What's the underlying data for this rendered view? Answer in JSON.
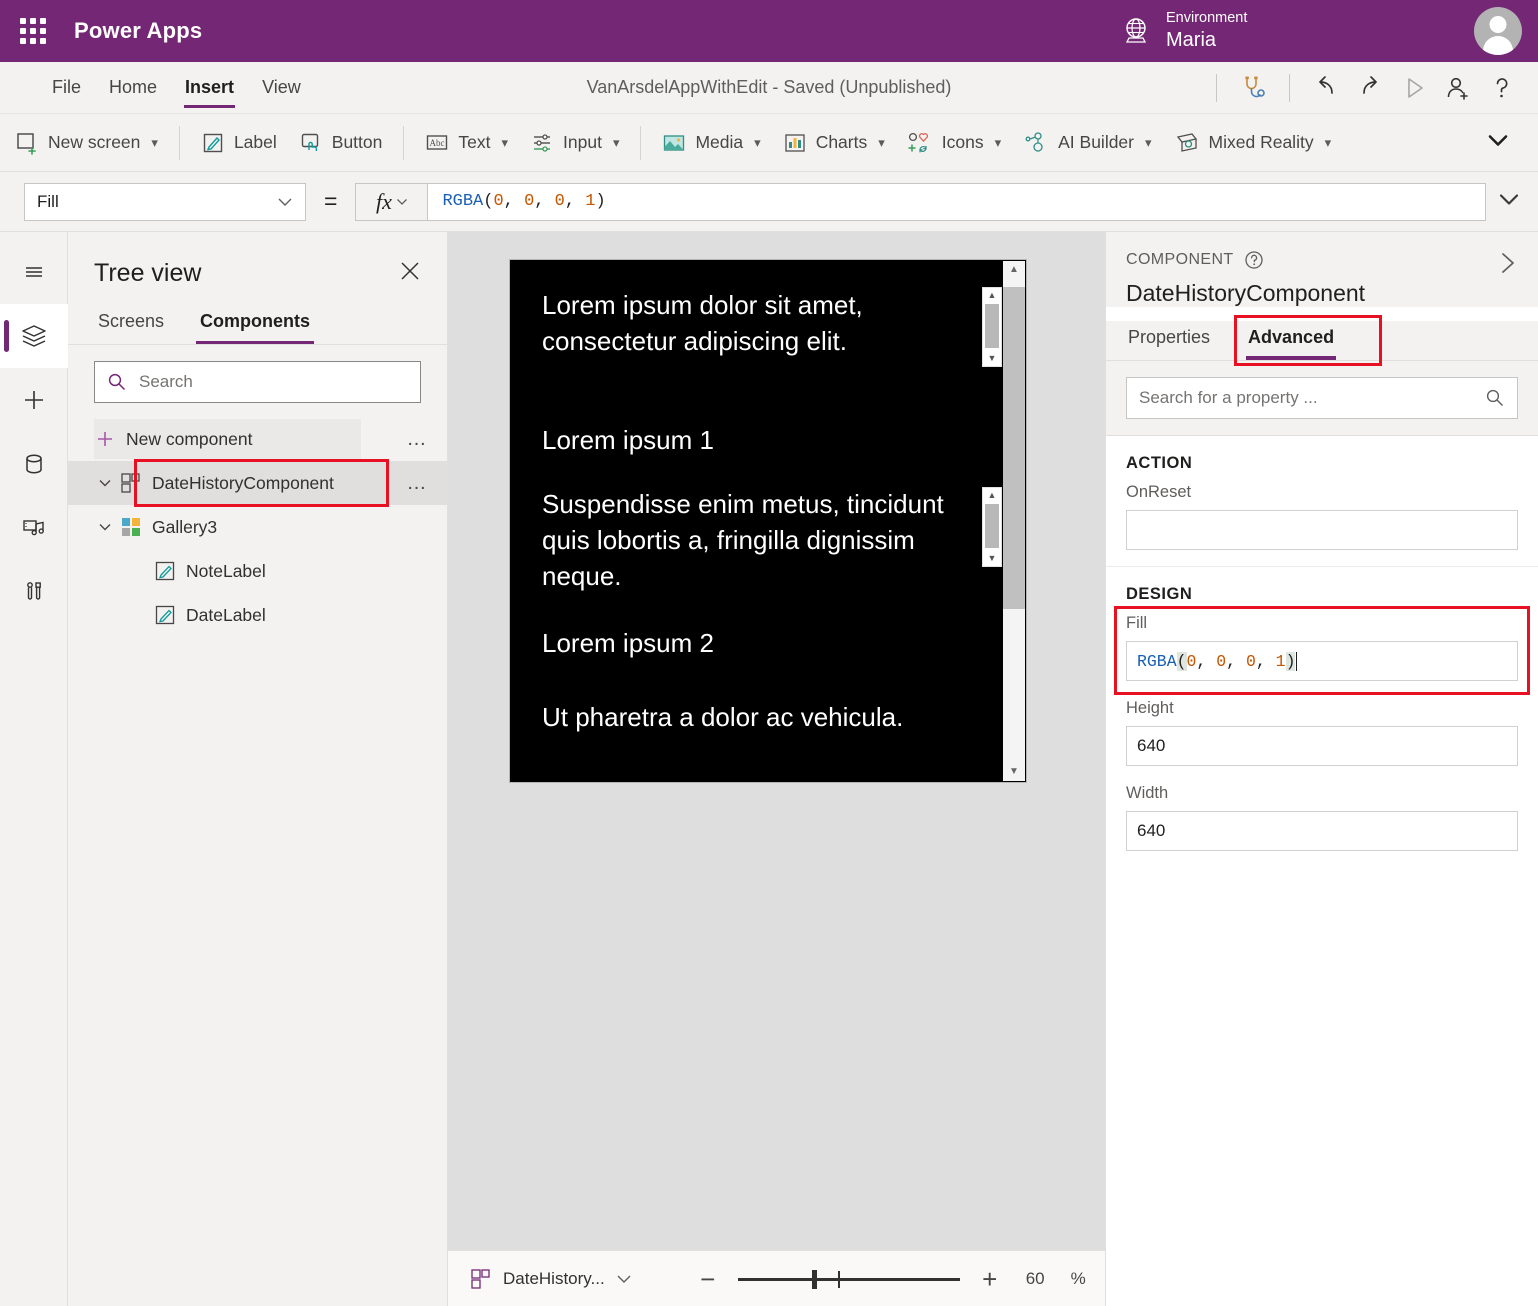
{
  "topbar": {
    "brand": "Power Apps",
    "waffle_icon": "app-launcher-icon",
    "environment_label": "Environment",
    "environment_name": "Maria",
    "globe_icon": "globe-icon",
    "avatar_icon": "user-avatar"
  },
  "menubar": {
    "items": [
      {
        "label": "File",
        "active": false
      },
      {
        "label": "Home",
        "active": false
      },
      {
        "label": "Insert",
        "active": true
      },
      {
        "label": "View",
        "active": false
      }
    ],
    "app_title": "VanArsdelAppWithEdit - Saved (Unpublished)",
    "tools": [
      {
        "name": "app-checker-icon",
        "title": "App checker"
      },
      {
        "name": "undo-icon",
        "title": "Undo"
      },
      {
        "name": "redo-icon",
        "title": "Redo"
      },
      {
        "name": "preview-play-icon",
        "title": "Preview the app"
      },
      {
        "name": "share-user-icon",
        "title": "Share"
      },
      {
        "name": "help-icon",
        "title": "Help"
      }
    ]
  },
  "ribbon": {
    "items": [
      {
        "label": "New screen",
        "icon": "new-screen-icon",
        "has_chevron": true
      },
      {
        "label": "Label",
        "icon": "label-icon",
        "has_chevron": false
      },
      {
        "label": "Button",
        "icon": "button-icon",
        "has_chevron": false
      },
      {
        "label": "Text",
        "icon": "text-icon",
        "has_chevron": true
      },
      {
        "label": "Input",
        "icon": "input-icon",
        "has_chevron": true
      },
      {
        "label": "Media",
        "icon": "media-icon",
        "has_chevron": true
      },
      {
        "label": "Charts",
        "icon": "charts-icon",
        "has_chevron": true
      },
      {
        "label": "Icons",
        "icon": "icons-icon",
        "has_chevron": true
      },
      {
        "label": "AI Builder",
        "icon": "ai-builder-icon",
        "has_chevron": true
      },
      {
        "label": "Mixed Reality",
        "icon": "mixed-reality-icon",
        "has_chevron": true
      }
    ],
    "expand_icon": "chevron-down-icon"
  },
  "formula_bar": {
    "property": "Fill",
    "equals": "=",
    "fx_label": "fx",
    "formula": {
      "function": "RGBA",
      "open": "(",
      "args": [
        "0",
        "0",
        "0",
        "1"
      ],
      "close": ")",
      "full": "RGBA(0, 0, 0, 1)"
    },
    "expand_icon": "chevron-down-icon"
  },
  "rail": {
    "items": [
      {
        "name": "hamburger-menu-icon",
        "active": false
      },
      {
        "name": "tree-view-layers-icon",
        "active": true
      },
      {
        "name": "insert-plus-icon",
        "active": false
      },
      {
        "name": "data-sources-icon",
        "active": false
      },
      {
        "name": "media-library-icon",
        "active": false
      },
      {
        "name": "advanced-tools-icon",
        "active": false
      }
    ]
  },
  "tree_view": {
    "title": "Tree view",
    "close_icon": "close-icon",
    "tabs": [
      {
        "label": "Screens",
        "active": false
      },
      {
        "label": "Components",
        "active": true
      }
    ],
    "search_placeholder": "Search",
    "search_value": "",
    "search_icon": "search-icon",
    "new_component_label": "New component",
    "new_component_icon": "plus-icon",
    "overflow_icon": "ellipsis-icon",
    "nodes": [
      {
        "label": "DateHistoryComponent",
        "icon": "component-icon",
        "level": 0,
        "expanded": true,
        "selected": true,
        "highlighted": true
      },
      {
        "label": "Gallery3",
        "icon": "gallery-icon",
        "level": 1,
        "expanded": true,
        "selected": false,
        "highlighted": false
      },
      {
        "label": "NoteLabel",
        "icon": "label-icon",
        "level": 2,
        "expanded": false,
        "selected": false,
        "highlighted": false
      },
      {
        "label": "DateLabel",
        "icon": "label-icon",
        "level": 2,
        "expanded": false,
        "selected": false,
        "highlighted": false
      }
    ]
  },
  "canvas": {
    "background_color": "#dedede",
    "component_fill": "#000000",
    "gallery_items": [
      {
        "note": "Lorem ipsum dolor sit amet, consectetur adipiscing elit.",
        "date": "Lorem ipsum 1"
      },
      {
        "note": "Suspendisse enim metus, tincidunt quis lobortis a, fringilla dignissim neque.",
        "date": "Lorem ipsum 2"
      },
      {
        "note": "Ut pharetra a dolor ac vehicula.",
        "date": ""
      }
    ]
  },
  "status_bar": {
    "component_name": "DateHistory...",
    "component_icon": "component-icon",
    "component_chevron": "chevron-down-icon",
    "zoom_out_icon": "minus-icon",
    "zoom_in_icon": "plus-icon",
    "zoom_value": "60",
    "zoom_unit": "%",
    "fit_screen_icon": "expand-diagonal-icon"
  },
  "properties_panel": {
    "kicker": "COMPONENT",
    "help_icon": "help-circle-icon",
    "collapse_icon": "chevron-right-icon",
    "component_name": "DateHistoryComponent",
    "tabs": [
      {
        "label": "Properties",
        "active": false,
        "highlighted": false
      },
      {
        "label": "Advanced",
        "active": true,
        "highlighted": true
      }
    ],
    "search_placeholder": "Search for a property ...",
    "search_value": "",
    "search_icon": "search-icon",
    "sections": [
      {
        "title": "ACTION",
        "fields": [
          {
            "label": "OnReset",
            "value": "",
            "type": "formula",
            "highlighted": false
          }
        ]
      },
      {
        "title": "DESIGN",
        "fields": [
          {
            "label": "Fill",
            "value": "RGBA(0, 0, 0, 1)",
            "type": "formula",
            "highlighted": true
          },
          {
            "label": "Height",
            "value": "640",
            "type": "number",
            "highlighted": false
          },
          {
            "label": "Width",
            "value": "640",
            "type": "number",
            "highlighted": false
          }
        ]
      }
    ]
  },
  "colors": {
    "brand_purple": "#742774",
    "accent_purple": "#742774",
    "highlight_red": "#e81123",
    "canvas_gray": "#dedede",
    "chrome_gray": "#f3f2f1"
  }
}
